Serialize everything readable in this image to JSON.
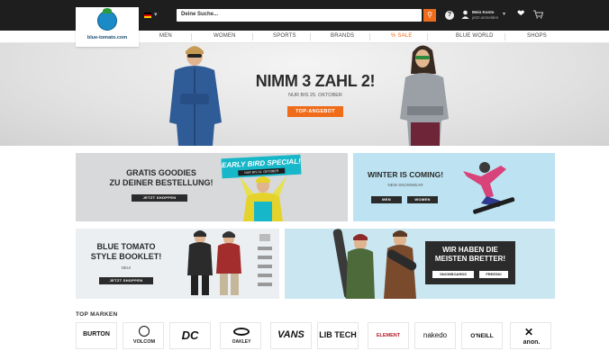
{
  "header": {
    "logo_text": "blue-tomato.com",
    "search_placeholder": "Deine Suche...",
    "account_line1": "Mein Konto",
    "account_line2": "jetzt anmelden",
    "help_label": "?",
    "icons": [
      "flag-de-icon",
      "search-icon",
      "help-icon",
      "user-icon",
      "heart-icon",
      "cart-icon"
    ]
  },
  "nav": {
    "items": [
      "MEN",
      "WOMEN",
      "SPORTS",
      "BRANDS",
      "% SALE",
      "BLUE WORLD",
      "SHOPS"
    ]
  },
  "hero": {
    "headline": "NIMM 3 ZAHL 2!",
    "subline": "NUR BIS 25. OKTOBER",
    "cta": "TOP-ANGEBOT"
  },
  "banners": {
    "goodies": {
      "title_line1": "GRATIS GOODIES",
      "title_line2": "ZU DEINER BESTELLUNG!",
      "button": "JETZT SHOPPEN",
      "badge_title": "EARLY BIRD SPECIAL!",
      "badge_sub": "NUR BIS 31. OKTOBER"
    },
    "winter": {
      "title": "WINTER IS COMING!",
      "sub": "NEW SNOWWEAR",
      "button_men": "MEN",
      "button_women": "WOMEN"
    },
    "booklet": {
      "title_line1": "BLUE TOMATO",
      "title_line2": "STYLE BOOKLET!",
      "new_label": "NEU!",
      "button": "JETZT SHOPPEN"
    },
    "boards": {
      "title_line1": "WIR HABEN DIE",
      "title_line2": "MEISTEN BRETTER!",
      "button_snowboards": "SNOWBOARDS",
      "button_freeski": "FREESKI"
    }
  },
  "brands": {
    "title": "TOP MARKEN",
    "items": [
      "BURTON",
      "VOLCOM",
      "DC",
      "OAKLEY",
      "VANS",
      "LIB TECH",
      "ELEMENT",
      "nakedo",
      "O'NEILL",
      "anon."
    ]
  },
  "colors": {
    "accent": "#ef6c1a",
    "topbar": "#1e1e1e",
    "badge": "#16b7c9"
  }
}
